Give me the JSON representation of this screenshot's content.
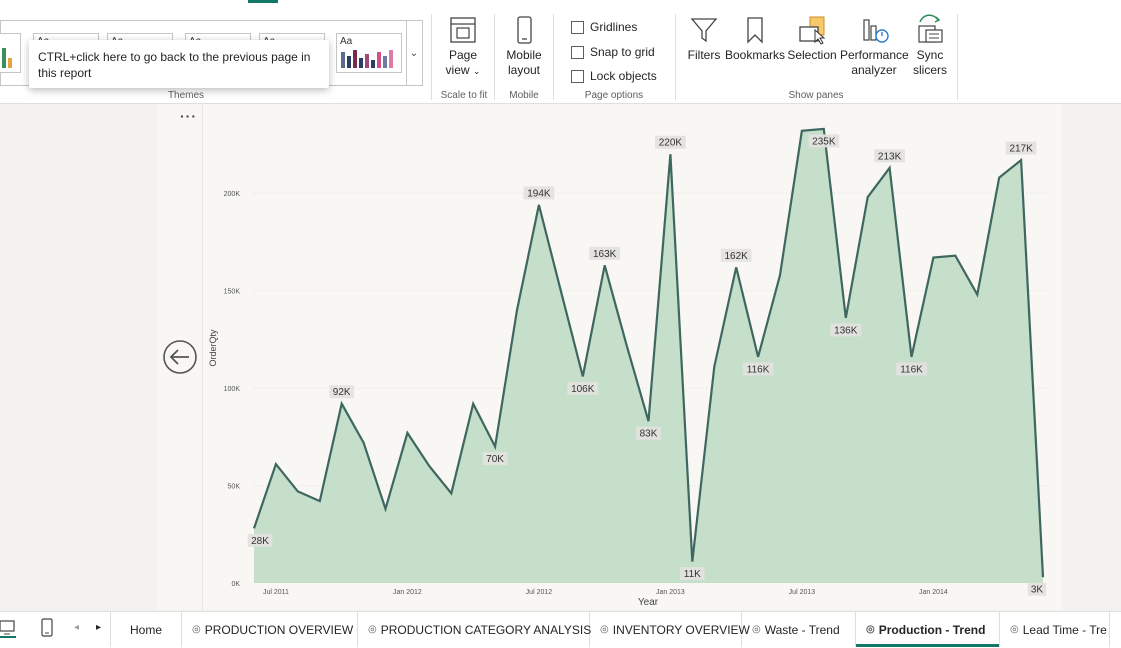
{
  "ribbon": {
    "themes_label": "Themes",
    "theme_thumb_text": "Aa",
    "page_view": {
      "line1": "Page",
      "line2": "view",
      "group": "Scale to fit"
    },
    "mobile": {
      "line1": "Mobile",
      "line2": "layout",
      "group": "Mobile"
    },
    "page_options": {
      "gridlines": "Gridlines",
      "snap": "Snap to grid",
      "lock": "Lock objects",
      "group": "Page options"
    },
    "show_panes": {
      "filters": "Filters",
      "bookmarks": "Bookmarks",
      "selection": "Selection",
      "performance_1": "Performance",
      "performance_2": "analyzer",
      "sync_1": "Sync",
      "sync_2": "slicers",
      "group": "Show panes"
    }
  },
  "tooltip": {
    "text": "CTRL+click here to go back to the previous page in this report"
  },
  "canvas": {
    "more_options": "···"
  },
  "chart_data": {
    "type": "area",
    "title": "",
    "xlabel": "Year",
    "ylabel": "OrderQty",
    "ylim": [
      0,
      235000
    ],
    "y_ticks": [
      "0K",
      "50K",
      "100K",
      "150K",
      "200K"
    ],
    "y_tick_values": [
      0,
      50000,
      100000,
      150000,
      200000
    ],
    "x_ticks": [
      "Jul 2011",
      "Jan 2012",
      "Jul 2012",
      "Jan 2013",
      "Jul 2013",
      "Jan 2014"
    ],
    "x_tick_index": [
      1,
      7,
      13,
      19,
      25,
      31
    ],
    "values": [
      28000,
      61000,
      47000,
      42000,
      92000,
      72000,
      38000,
      77000,
      60000,
      46000,
      92000,
      70000,
      140000,
      194000,
      150000,
      106000,
      163000,
      122000,
      83000,
      220000,
      11000,
      111000,
      162000,
      116000,
      158000,
      232000,
      233000,
      136000,
      198000,
      213000,
      116000,
      167000,
      168000,
      148000,
      208000,
      217000,
      3000
    ],
    "labels": [
      {
        "i": 0,
        "text": "28K",
        "pos": "below"
      },
      {
        "i": 4,
        "text": "92K",
        "pos": "above"
      },
      {
        "i": 11,
        "text": "70K",
        "pos": "below"
      },
      {
        "i": 13,
        "text": "194K",
        "pos": "above"
      },
      {
        "i": 15,
        "text": "106K",
        "pos": "below"
      },
      {
        "i": 16,
        "text": "163K",
        "pos": "above"
      },
      {
        "i": 18,
        "text": "83K",
        "pos": "below"
      },
      {
        "i": 19,
        "text": "220K",
        "pos": "above"
      },
      {
        "i": 20,
        "text": "11K",
        "pos": "below"
      },
      {
        "i": 22,
        "text": "162K",
        "pos": "above"
      },
      {
        "i": 23,
        "text": "116K",
        "pos": "below"
      },
      {
        "i": 26,
        "text": "235K",
        "pos": "below"
      },
      {
        "i": 27,
        "text": "136K",
        "pos": "below"
      },
      {
        "i": 29,
        "text": "213K",
        "pos": "above"
      },
      {
        "i": 30,
        "text": "116K",
        "pos": "below"
      },
      {
        "i": 35,
        "text": "217K",
        "pos": "above"
      },
      {
        "i": 36,
        "text": "3K",
        "pos": "below"
      }
    ],
    "colors": {
      "line": "#3f6760",
      "fill": "#c5dfca",
      "label_bg": "#e3e2de",
      "grid": "#dddcd8"
    }
  },
  "tabs": [
    {
      "label": "Home",
      "hidden": false,
      "active": false
    },
    {
      "label": "PRODUCTION OVERVIEW",
      "hidden": true,
      "active": false
    },
    {
      "label": "PRODUCTION CATEGORY ANALYSIS",
      "hidden": true,
      "active": false
    },
    {
      "label": "INVENTORY OVERVIEW",
      "hidden": true,
      "active": false
    },
    {
      "label": "Waste - Trend",
      "hidden": true,
      "active": false
    },
    {
      "label": "Production - Trend",
      "hidden": true,
      "active": true
    },
    {
      "label": "Lead Time - Tre",
      "hidden": true,
      "active": false
    }
  ],
  "colors": {
    "accent": "#117865"
  }
}
